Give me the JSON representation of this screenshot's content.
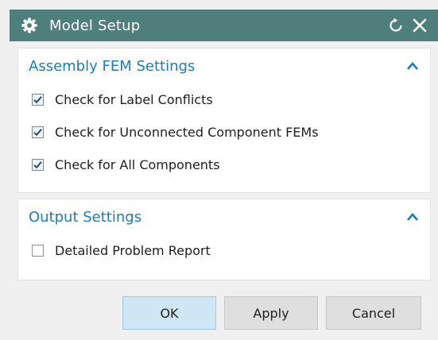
{
  "window": {
    "title": "Model Setup",
    "icons": {
      "app": "gear-icon",
      "reset": "reset-icon",
      "close": "close-icon"
    }
  },
  "groups": [
    {
      "title": "Assembly FEM Settings",
      "expanded": true,
      "options": [
        {
          "label": "Check for Label Conflicts",
          "checked": true
        },
        {
          "label": "Check for Unconnected Component FEMs",
          "checked": true
        },
        {
          "label": "Check for All Components",
          "checked": true
        }
      ]
    },
    {
      "title": "Output Settings",
      "expanded": true,
      "options": [
        {
          "label": "Detailed Problem Report",
          "checked": false
        }
      ]
    }
  ],
  "buttons": {
    "ok": "OK",
    "apply": "Apply",
    "cancel": "Cancel"
  },
  "colors": {
    "titlebar": "#4e7f7c",
    "group_title": "#1f7bb8",
    "ok_button": "#cfe6f5"
  }
}
